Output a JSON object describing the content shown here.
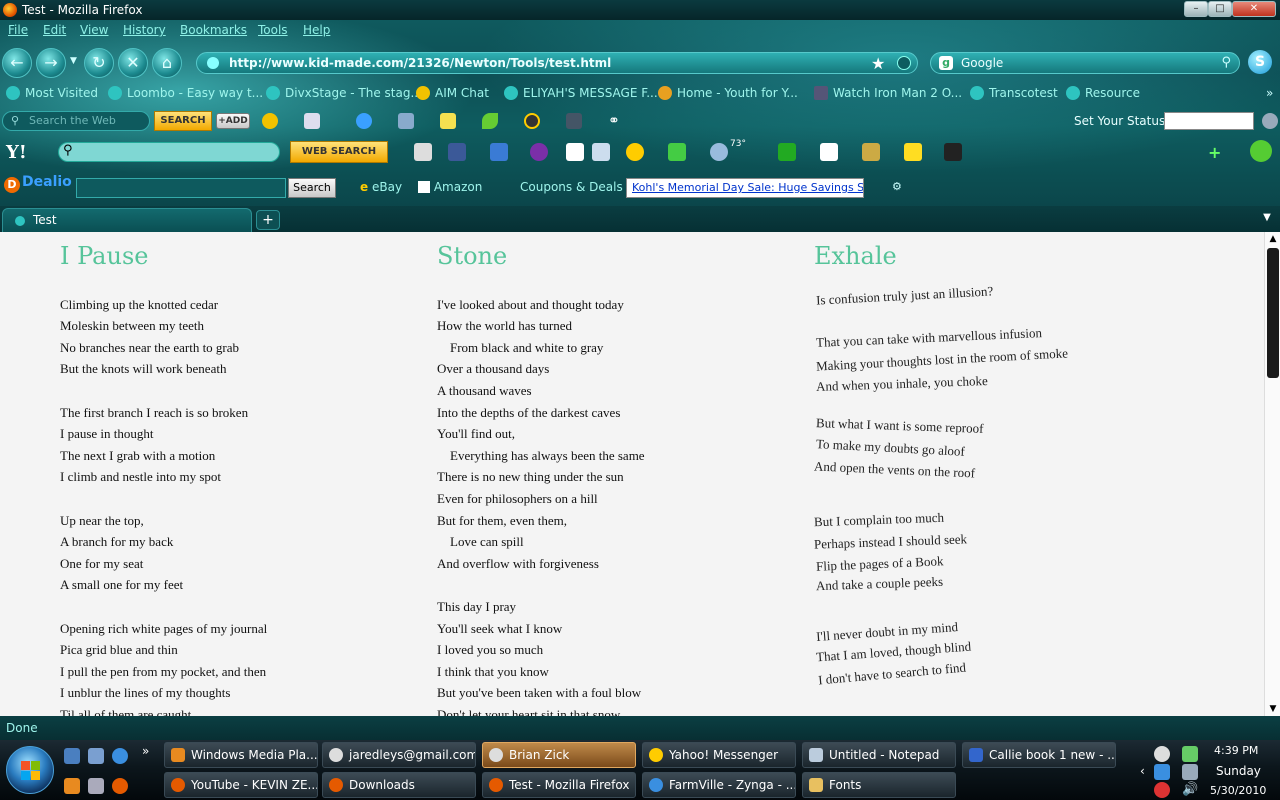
{
  "window": {
    "title": "Test - Mozilla Firefox"
  },
  "menu": [
    "File",
    "Edit",
    "View",
    "History",
    "Bookmarks",
    "Tools",
    "Help"
  ],
  "nav": {
    "url": "http://www.kid-made.com/21326/Newton/Tools/test.html",
    "search_engine": "Google"
  },
  "bookmarks": [
    "Most Visited",
    "Loombo - Easy way t...",
    "DivxStage - The stag...",
    "AIM Chat",
    "ELIYAH'S MESSAGE F...",
    "Home - Youth for Y...",
    "Watch Iron Man 2 O...",
    "Transcotest",
    "Resource"
  ],
  "aim_toolbar": {
    "search_placeholder": "Search the Web",
    "search_button": "SEARCH",
    "add_button": "+ADD",
    "status_label": "Set Your Status:"
  },
  "yahoo_toolbar": {
    "logo": "Y!",
    "search_button": "WEB SEARCH",
    "weather_temp": "73°"
  },
  "dealio_toolbar": {
    "logo": "Dealio",
    "search_button": "Search",
    "links": [
      "eBay",
      "Amazon",
      "Coupons & Deals"
    ],
    "promo": "Kohl's Memorial Day Sale: Huge Savings Stor"
  },
  "tabs": [
    {
      "label": "Test"
    }
  ],
  "poems": [
    {
      "title": "I Pause",
      "lines": [
        "Climbing up the knotted cedar",
        "Moleskin between my teeth",
        "No branches near the earth to grab",
        "But the knots will work beneath",
        "",
        "The first branch I reach is so broken",
        "I pause in thought",
        "The next I grab with a motion",
        "I climb and nestle into my spot",
        "",
        "Up near the top,",
        "A branch for my back",
        "One for my seat",
        "A small one for my feet",
        "",
        "Opening rich white pages of my journal",
        "Pica grid blue and thin",
        "I pull the pen from my pocket, and then",
        "I unblur the lines of my thoughts",
        "Til all of them are caught"
      ]
    },
    {
      "title": "Stone",
      "lines": [
        "I've looked about and thought today",
        "How the world has turned",
        "    From black and white to gray",
        "Over a thousand days",
        "A thousand waves",
        "Into the depths of the darkest caves",
        "You'll find out,",
        "    Everything has always been the same",
        "There is no new thing under the sun",
        "Even for philosophers on a hill",
        "But for them, even them,",
        "    Love can spill",
        "And overflow with forgiveness",
        "",
        "This day I pray",
        "You'll seek what I know",
        "I loved you so much",
        "I think that you know",
        "But you've been taken with a foul blow",
        "Don't let your heart sit in that snow"
      ]
    },
    {
      "title": "Exhale",
      "lines": [
        "Is confusion truly just an illusion?",
        "That you can take with marvellous infusion",
        "Making your thoughts lost in the room of smoke",
        "And when you inhale, you choke",
        "But what I want is some reproof",
        "To make my doubts go aloof",
        "And open the vents on the roof",
        "But I complain too much",
        "Perhaps instead I should seek",
        "Flip the pages of a Book",
        "And take a couple peeks",
        "I'll never doubt in my mind",
        "That I am loved, though blind",
        "I don't have to search to find"
      ]
    }
  ],
  "status_text": "Done",
  "taskbar": {
    "tasks": [
      "Windows Media Pla...",
      "jaredleys@gmail.com",
      "Brian Zick",
      "Yahoo! Messenger",
      "Untitled - Notepad",
      "Callie book 1 new - ...",
      "YouTube - KEVIN ZE...",
      "Downloads",
      "Test - Mozilla Firefox",
      "FarmVille - Zynga - ...",
      "Fonts"
    ],
    "time": "4:39 PM",
    "day": "Sunday",
    "date": "5/30/2010"
  }
}
